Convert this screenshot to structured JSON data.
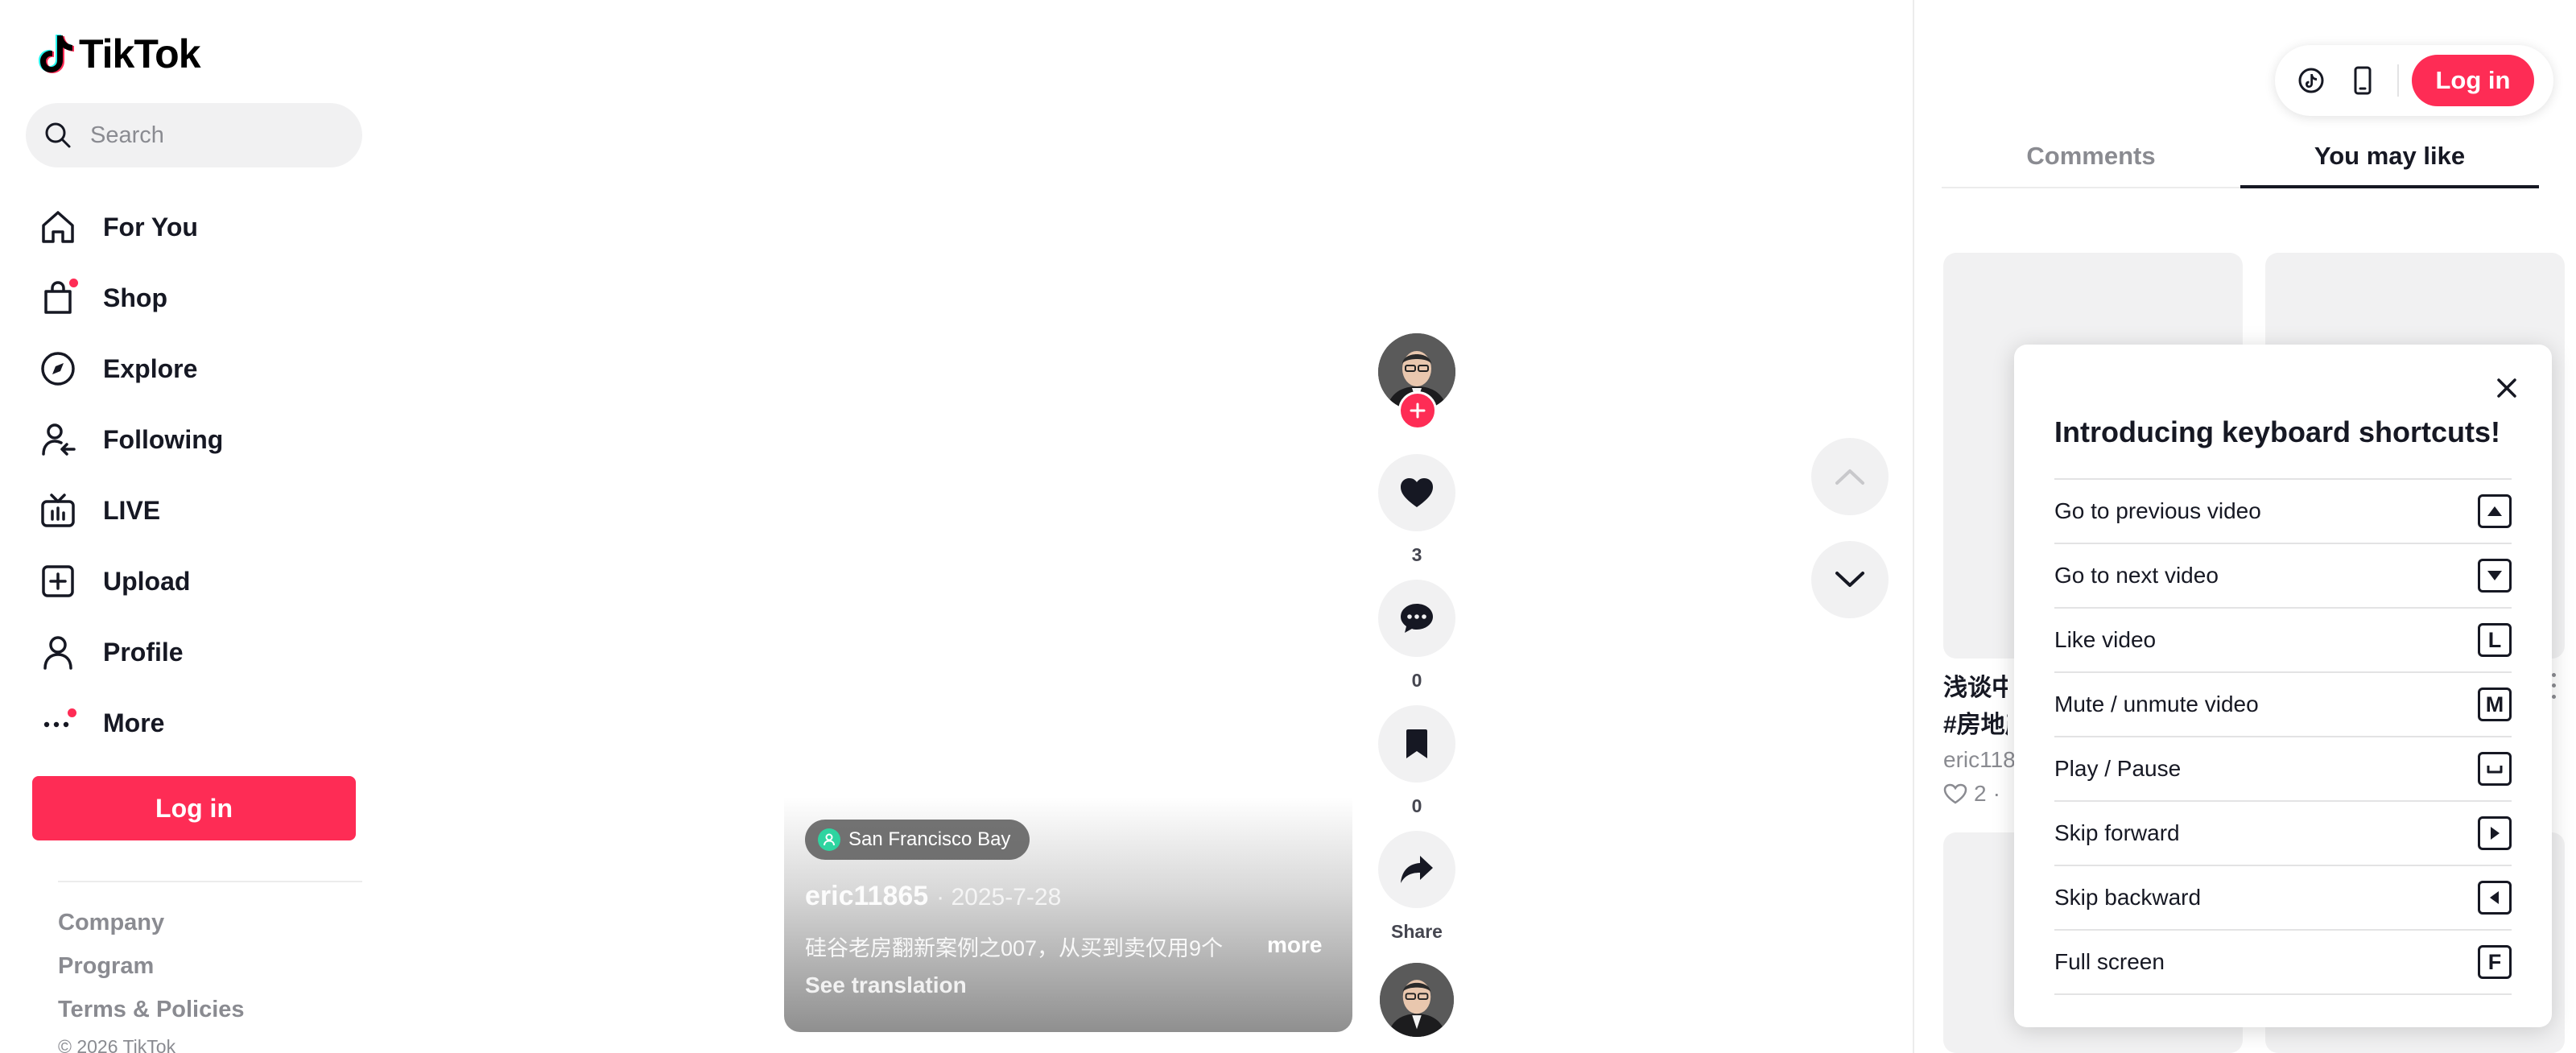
{
  "brand": {
    "name": "TikTok"
  },
  "search": {
    "placeholder": "Search"
  },
  "nav": {
    "items": [
      {
        "label": "For You",
        "icon": "home-icon"
      },
      {
        "label": "Shop",
        "icon": "shopping-bag-icon"
      },
      {
        "label": "Explore",
        "icon": "compass-icon"
      },
      {
        "label": "Following",
        "icon": "following-icon"
      },
      {
        "label": "LIVE",
        "icon": "live-tv-icon"
      },
      {
        "label": "Upload",
        "icon": "upload-plus-icon"
      },
      {
        "label": "Profile",
        "icon": "profile-icon"
      },
      {
        "label": "More",
        "icon": "more-dots-icon"
      }
    ]
  },
  "sidebar": {
    "login_label": "Log in",
    "footer_links": [
      "Company",
      "Program",
      "Terms & Policies"
    ],
    "copyright": "© 2026 TikTok"
  },
  "video": {
    "location": "San Francisco Bay",
    "author": "eric11865",
    "date": "· 2025-7-28",
    "description": "硅谷老房翻新案例之007，从买到卖仅用9个",
    "more_label": "more",
    "see_translation": "See translation",
    "likes": "3",
    "comments": "0",
    "bookmarks": "0",
    "share_label": "Share"
  },
  "header": {
    "login_label": "Log in"
  },
  "tabs": [
    {
      "label": "Comments",
      "active": false
    },
    {
      "label": "You may like",
      "active": true
    }
  ],
  "recommended": {
    "title_line1": "浅谈中",
    "title_line2": "#房地产",
    "author": "eric118",
    "likes": "2",
    "likes_suffix": " ·"
  },
  "shortcuts": {
    "title": "Introducing keyboard shortcuts!",
    "items": [
      {
        "label": "Go to previous video",
        "key": "▲"
      },
      {
        "label": "Go to next video",
        "key": "▼"
      },
      {
        "label": "Like video",
        "key": "L"
      },
      {
        "label": "Mute / unmute video",
        "key": "M"
      },
      {
        "label": "Play / Pause",
        "key": "␣"
      },
      {
        "label": "Skip forward",
        "key": "▶"
      },
      {
        "label": "Skip backward",
        "key": "◀"
      },
      {
        "label": "Full screen",
        "key": "F"
      }
    ]
  },
  "colors": {
    "accent": "#fe2c55",
    "text": "#161823",
    "muted": "#8a8b91",
    "surface": "#f1f1f2"
  }
}
